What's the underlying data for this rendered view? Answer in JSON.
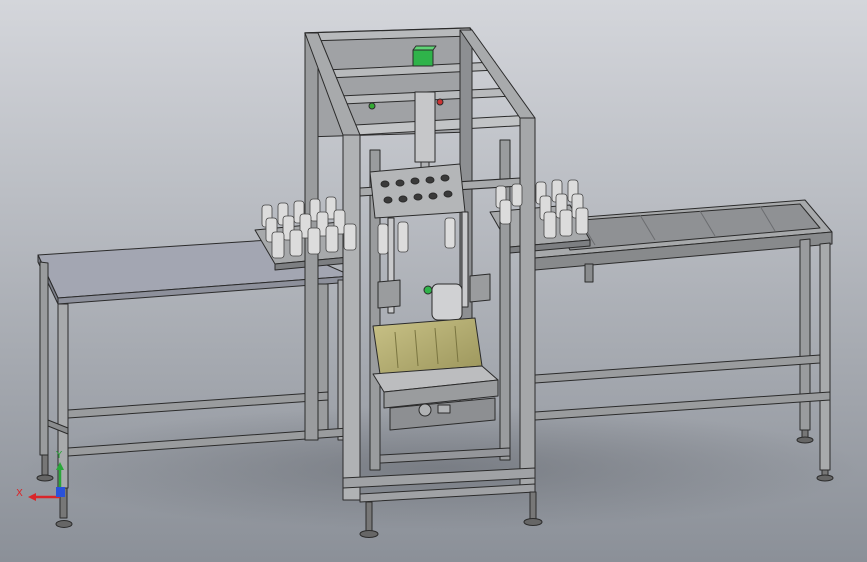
{
  "viewport": {
    "background_top": "#d4d6db",
    "background_bottom": "#8b9098"
  },
  "colors": {
    "frame": "#9a9c9e",
    "frame_dark": "#6b6d70",
    "frame_light": "#c6c7c9",
    "table_top": "#a3a6b2",
    "tray": "#b5b07a",
    "tray_dark": "#8a8550",
    "accent_green": "#2fb34a",
    "bottle": "#dcdcdc",
    "outline": "#2b2b2b"
  },
  "triad": {
    "x_label": "X",
    "y_label": "Y",
    "x_color": "#d9262a",
    "y_color": "#2aa63a",
    "z_color": "#2a52d9"
  },
  "icons": [
    "axis-triad-icon"
  ]
}
